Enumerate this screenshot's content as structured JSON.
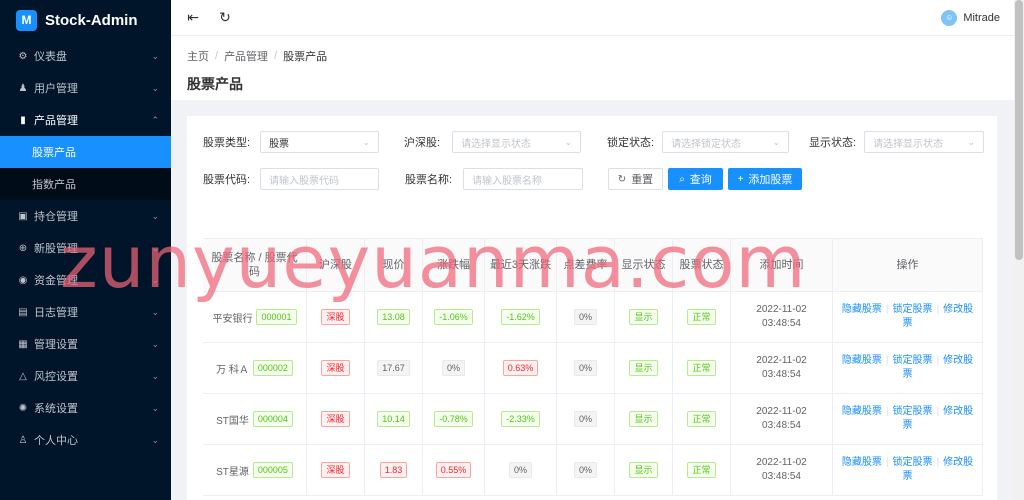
{
  "brand": {
    "title": "Stock-Admin",
    "logo_text": "M"
  },
  "sidebar": {
    "items": [
      {
        "label": "仪表盘",
        "icon": "dashboard-icon",
        "glyph": "⚙"
      },
      {
        "label": "用户管理",
        "icon": "users-icon",
        "glyph": "♟"
      },
      {
        "label": "产品管理",
        "icon": "chart-icon",
        "glyph": "▮"
      },
      {
        "label": "持仓管理",
        "icon": "position-icon",
        "glyph": "▣"
      },
      {
        "label": "新股管理",
        "icon": "ipo-icon",
        "glyph": "⊕"
      },
      {
        "label": "资金管理",
        "icon": "money-icon",
        "glyph": "◉"
      },
      {
        "label": "日志管理",
        "icon": "log-icon",
        "glyph": "▤"
      },
      {
        "label": "管理设置",
        "icon": "settings-grid-icon",
        "glyph": "▦"
      },
      {
        "label": "风控设置",
        "icon": "warning-icon",
        "glyph": "△"
      },
      {
        "label": "系统设置",
        "icon": "gear-icon",
        "glyph": "✺"
      },
      {
        "label": "个人中心",
        "icon": "person-icon",
        "glyph": "♙"
      }
    ],
    "sub": [
      {
        "label": "股票产品"
      },
      {
        "label": "指数产品"
      }
    ]
  },
  "header": {
    "username": "Mitrade"
  },
  "breadcrumb": {
    "home": "主页",
    "section": "产品管理",
    "current": "股票产品"
  },
  "page_title": "股票产品",
  "filters": {
    "stock_type_label": "股票类型:",
    "stock_type_value": "股票",
    "market_label": "沪深股:",
    "market_placeholder": "请选择显示状态",
    "lock_label": "锁定状态:",
    "lock_placeholder": "请选择锁定状态",
    "show_label": "显示状态:",
    "show_placeholder": "请选择显示状态",
    "code_label": "股票代码:",
    "code_placeholder": "请输入股票代码",
    "name_label": "股票名称:",
    "name_placeholder": "请输入股票名称",
    "reset_label": "重置",
    "query_label": "查询",
    "add_label": "添加股票"
  },
  "table": {
    "headers": [
      "股票名称 / 股票代码",
      "沪深股",
      "现价",
      "涨跌幅",
      "最近3天涨跌",
      "点差费率",
      "显示状态",
      "股票状态",
      "添加时间",
      "操作"
    ],
    "rows": [
      {
        "name": "平安银行",
        "code": "000001",
        "market": "深股",
        "price": "13.08",
        "change": "-1.06%",
        "change3": "-1.62%",
        "fee": "0%",
        "show": "显示",
        "status": "正常",
        "date": "2022-11-02",
        "time": "03:48:54"
      },
      {
        "name": "万 科Ａ",
        "code": "000002",
        "market": "深股",
        "price": "17.67",
        "change": "0%",
        "change3": "0.63%",
        "fee": "0%",
        "show": "显示",
        "status": "正常",
        "date": "2022-11-02",
        "time": "03:48:54"
      },
      {
        "name": "ST国华",
        "code": "000004",
        "market": "深股",
        "price": "10.14",
        "change": "-0.78%",
        "change3": "-2.33%",
        "fee": "0%",
        "show": "显示",
        "status": "正常",
        "date": "2022-11-02",
        "time": "03:48:54"
      },
      {
        "name": "ST星源",
        "code": "000005",
        "market": "深股",
        "price": "1.83",
        "change": "0.55%",
        "change3": "0%",
        "fee": "0%",
        "show": "显示",
        "status": "正常",
        "date": "2022-11-02",
        "time": "03:48:54"
      }
    ],
    "ops": {
      "hide": "隐藏股票",
      "lock": "锁定股票",
      "edit": "修改股票"
    }
  },
  "watermark": "zunyueyuanma.com",
  "colors": {
    "primary": "#1890ff",
    "sidebar_bg": "#001529",
    "up": "#f5222d",
    "down": "#52c41a"
  }
}
